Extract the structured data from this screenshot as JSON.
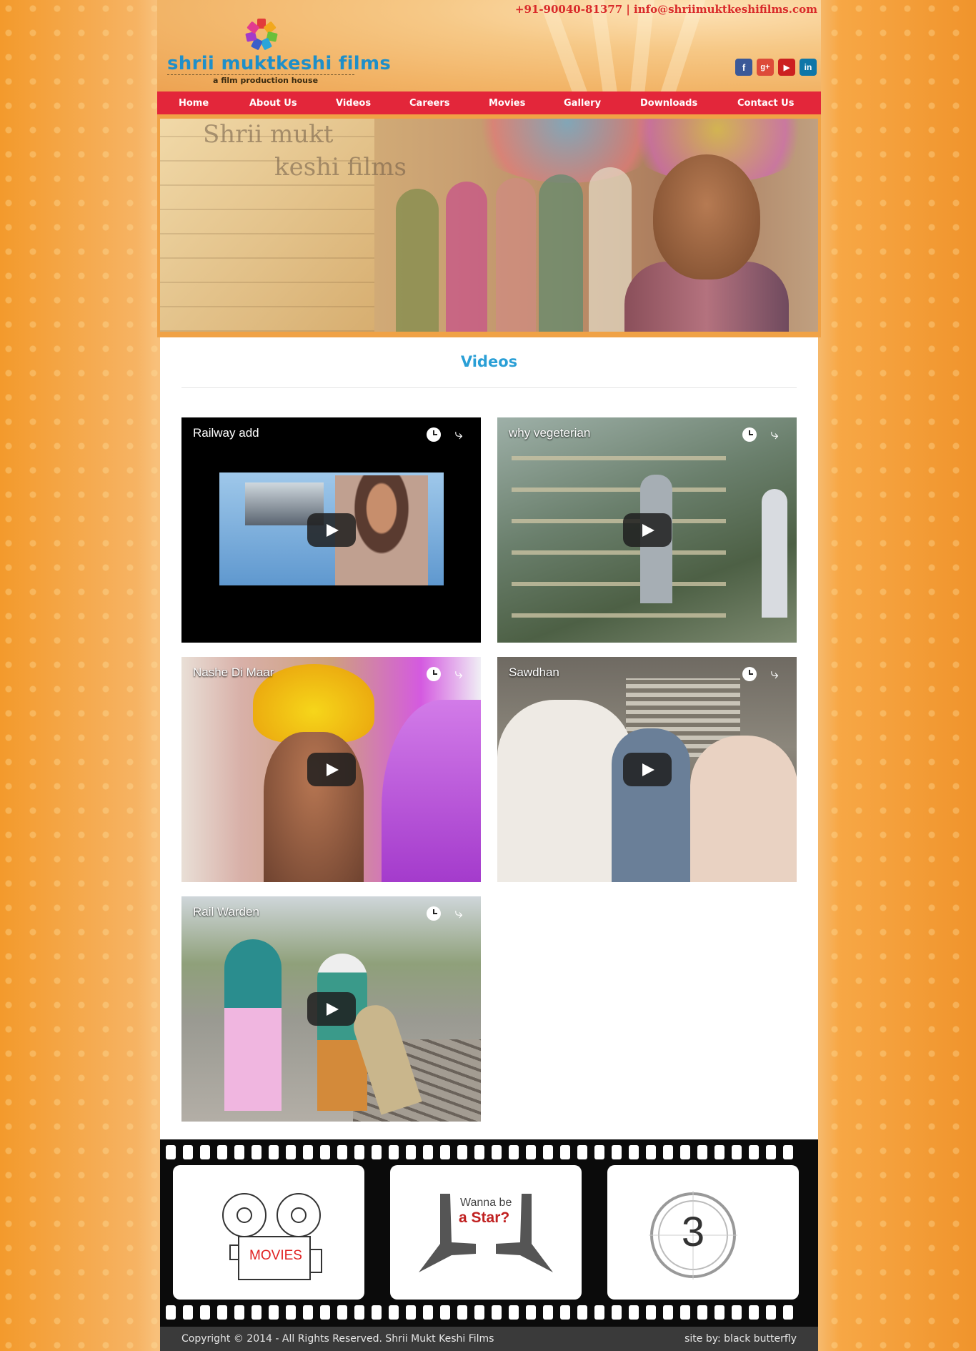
{
  "header": {
    "logo_text": "shrii muktkeshi films",
    "tagline": "a film production house",
    "contact": "+91-90040-81377 | info@shriimuktkeshifilms.com",
    "social": [
      {
        "name": "facebook-icon",
        "glyph": "f",
        "color": "#3b5998"
      },
      {
        "name": "google-plus-icon",
        "glyph": "g+",
        "color": "#dd4b39"
      },
      {
        "name": "youtube-icon",
        "glyph": "▶",
        "color": "#cc2020"
      },
      {
        "name": "linkedin-icon",
        "glyph": "in",
        "color": "#0e76a8"
      }
    ]
  },
  "nav": {
    "items": [
      "Home",
      "About Us",
      "Videos",
      "Careers",
      "Movies",
      "Gallery",
      "Downloads",
      "Contact Us"
    ]
  },
  "banner": {
    "watermark_line1": "Shrii mukt",
    "watermark_line2": "keshi films"
  },
  "content": {
    "title": "Videos",
    "videos": [
      {
        "title": "Railway add"
      },
      {
        "title": "why vegeterian"
      },
      {
        "title": "Nashe Di Maar"
      },
      {
        "title": "Sawdhan"
      },
      {
        "title": "Rail Warden"
      }
    ]
  },
  "filmstrip": {
    "movies_label": "MOVIES",
    "star_line1": "Wanna be",
    "star_line2": "a Star?",
    "countdown": "3"
  },
  "footer": {
    "copyright": "Copyright © 2014 - All Rights Reserved. Shrii Mukt Keshi Films",
    "credit": "site by: black butterfly"
  },
  "colors": {
    "nav_bg": "#e3263a",
    "title_blue": "#2a9fd6",
    "logo_blue": "#1e8fc9",
    "contact_red": "#d92a2a"
  }
}
